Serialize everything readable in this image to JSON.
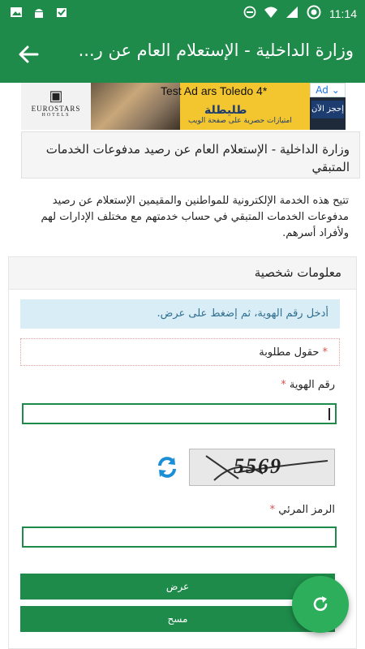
{
  "status_bar": {
    "time": "11:14",
    "left_icons": [
      "image-icon",
      "android-icon",
      "check-icon"
    ],
    "right_icons": [
      "block-icon",
      "wifi-icon",
      "signal-icon",
      "record-icon"
    ]
  },
  "app_bar": {
    "title": "وزارة الداخلية - الإستعلام العام عن ر...",
    "back_icon": "arrow-back-icon"
  },
  "ad": {
    "brand_line1": "EUROSTARS",
    "brand_line2": "HOTELS",
    "test_label": "Test Ad",
    "hotel_name": "ars Toledo 4*",
    "headline": "طليطلة",
    "subline": "امتيازات حصرية على صفحة الويب",
    "book_button": "إحجز الآن",
    "ad_choice": "Ad"
  },
  "page": {
    "heading": "وزارة الداخلية - الإستعلام العام عن رصيد مدفوعات الخدمات المتبقي",
    "intro": "تتيح هذه الخدمة الإلكترونية للمواطنين والمقيمين الإستعلام عن رصيد مدفوعات الخدمات المتبقي في حساب خدمتهم مع مختلف الإدارات لهم ولأفراد أسرهم."
  },
  "form": {
    "section_title": "معلومات شخصية",
    "info_message": "أدخل رقم الهوية، ثم إضغط على عرض.",
    "required_note": "حقول مطلوبة",
    "required_star": "*",
    "id_label": "رقم الهوية",
    "id_value": "",
    "captcha_text": "5569",
    "captcha_label": "الرمز المرئي",
    "captcha_value": "",
    "submit_button": "عرض",
    "clear_button": "مسح"
  },
  "colors": {
    "primary": "#1e8b4a",
    "fab": "#2cae5a",
    "info_bg": "#d9edf7",
    "info_text": "#31708f",
    "required_star": "#d9534f",
    "refresh_icon": "#1a8fd6"
  }
}
